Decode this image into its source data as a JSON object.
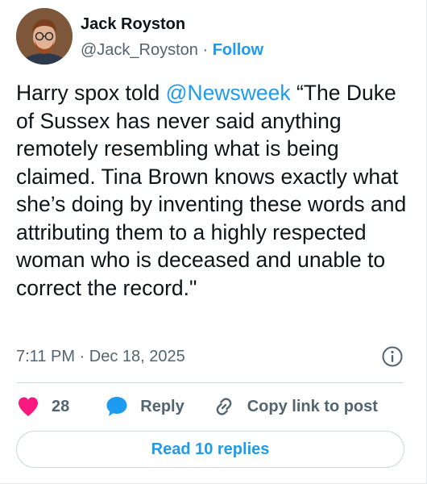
{
  "author": {
    "display_name": "Jack Royston",
    "handle": "@Jack_Royston",
    "separator": " · ",
    "follow_label": "Follow"
  },
  "tweet": {
    "text_before": "Harry spox told ",
    "mention": "@Newsweek",
    "text_after": " “The Duke of Sussex has never said anything remotely resembling what is being claimed. Tina Brown knows exactly what she’s doing by inventing these words and attributing them to a highly respected woman who is deceased and unable to correct the record.\"",
    "timestamp": "7:11 PM · Dec 18, 2025"
  },
  "actions": {
    "like_count": "28",
    "reply_label": "Reply",
    "copy_link_label": "Copy link to post"
  },
  "read_replies_label": "Read 10 replies",
  "icons": {
    "heart": "heart-icon",
    "reply": "reply-bubble-icon",
    "link": "link-icon",
    "info": "info-icon"
  },
  "colors": {
    "accent": "#1d9bf0",
    "like": "#f91880",
    "text": "#0f1419",
    "muted": "#536471"
  }
}
